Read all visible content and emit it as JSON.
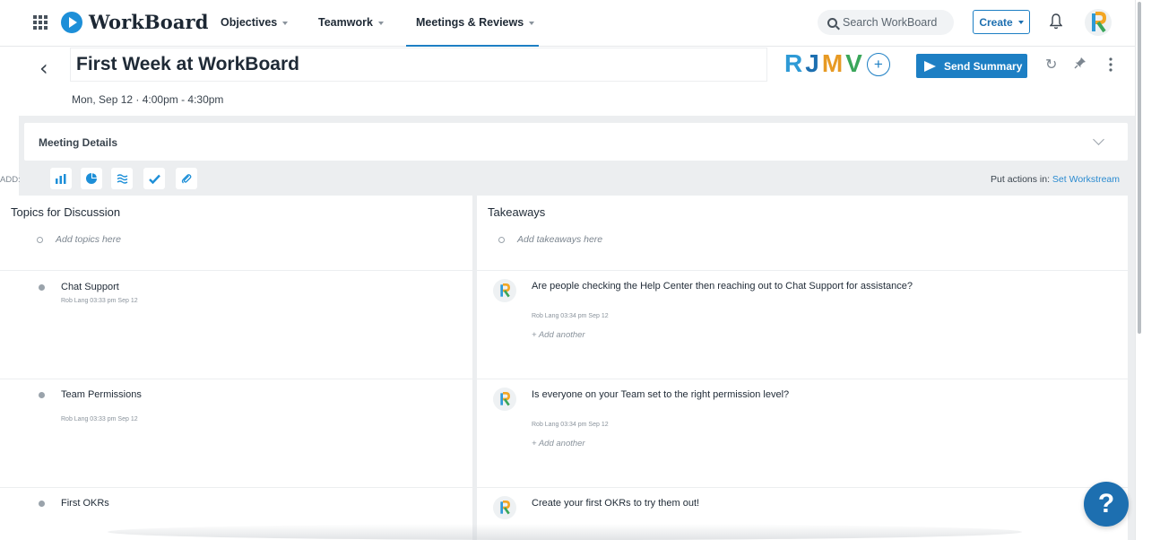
{
  "nav": {
    "brand": "WorkBoard",
    "items": [
      {
        "label": "Objectives"
      },
      {
        "label": "Teamwork"
      },
      {
        "label": "Meetings & Reviews"
      }
    ],
    "search_placeholder": "Search WorkBoard",
    "create_label": "Create"
  },
  "meeting": {
    "title": "First Week at WorkBoard",
    "datetime": "Mon, Sep 12 · 4:00pm - 4:30pm",
    "attendees": [
      "R",
      "J",
      "M",
      "V"
    ],
    "add_attendee": "+",
    "send_label": "Send Summary"
  },
  "details": {
    "label": "Meeting Details"
  },
  "add_bar": {
    "label": "ADD:",
    "put_actions": "Put actions in:",
    "set_workstream": "Set Workstream",
    "close": "×"
  },
  "topics": {
    "header": "Topics for Discussion",
    "placeholder": "Add topics here",
    "items": [
      {
        "title": "Chat Support",
        "meta": "Rob Lang   03:33 pm Sep 12"
      },
      {
        "title": "Team Permissions",
        "meta": "Rob Lang   03:33 pm Sep 12"
      },
      {
        "title": "First OKRs",
        "meta": ""
      }
    ]
  },
  "takeaways": {
    "header": "Takeaways",
    "placeholder": "Add takeaways here",
    "add_another": "+ Add another",
    "items": [
      {
        "text": "Are people checking the Help Center then reaching out to Chat Support for assistance?",
        "meta": "Rob Lang   03:34 pm Sep 12"
      },
      {
        "text": "Is everyone on your Team set to the right permission level?",
        "meta": "Rob Lang   03:34 pm Sep 12"
      },
      {
        "text": "Create your first OKRs to try them out!"
      }
    ]
  },
  "help_label": "?",
  "colors": {
    "accent": "#1d7fc4",
    "band": "#eceef0"
  }
}
